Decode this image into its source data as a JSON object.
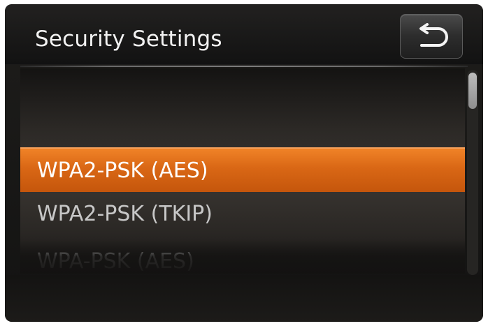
{
  "header": {
    "title": "Security Settings",
    "back_icon": "return-arrow-icon"
  },
  "list": {
    "items": [
      {
        "label": ""
      },
      {
        "label": "WPA2-PSK (AES)",
        "selected": true
      },
      {
        "label": "WPA2-PSK (TKIP)",
        "selected": false
      },
      {
        "label": "WPA-PSK (AES)",
        "selected": false
      }
    ]
  },
  "scrollbar": {
    "position": 0.0
  },
  "colors": {
    "accent": "#e0701b",
    "background": "#141312",
    "text": "#f2f2f2"
  }
}
